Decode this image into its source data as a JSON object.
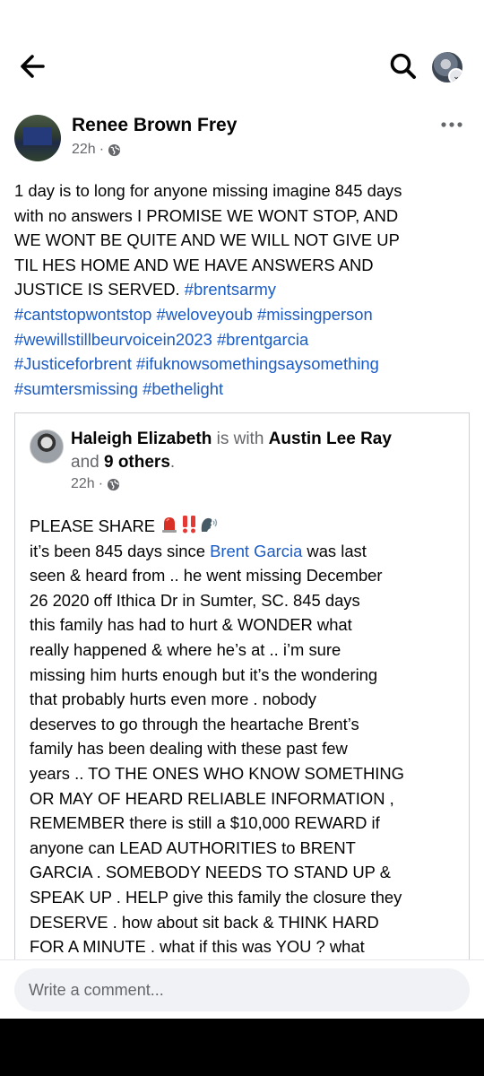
{
  "post": {
    "author": "Renee Brown Frey",
    "time": "22h",
    "separator": "·",
    "text_lines": [
      "1 day is to long for anyone missing imagine 845 days",
      "with no answers I PROMISE WE WONT STOP, AND",
      "WE WONT BE QUITE AND WE WILL NOT GIVE UP",
      "TIL HES HOME AND WE HAVE ANSWERS AND"
    ],
    "text_line5": "JUSTICE IS SERVED. ",
    "hashtags": [
      "#brentsarmy",
      "#cantstopwontstop",
      "#weloveyoub",
      "#missingperson",
      "#wewillstillbeurvoicein2023",
      "#brentgarcia",
      "#Justiceforbrent",
      "#ifuknowsomethingsaysomething",
      "#sumtersmissing",
      "#bethelight"
    ]
  },
  "shared": {
    "author": "Haleigh Elizabeth",
    "with_text": " is with ",
    "with_person": "Austin Lee Ray",
    "and_text": "and ",
    "others": "9 others",
    "period": ".",
    "time": "22h",
    "separator": "·",
    "line1": "PLEASE SHARE ",
    "line2_a": "it’s been 845 days since ",
    "line2_link": "Brent Garcia",
    "line2_b": " was last",
    "lines": [
      "seen & heard from .. he went missing December",
      "26 2020 off Ithica Dr in Sumter, SC. 845 days",
      "this family has had to hurt & WONDER what",
      "really happened & where he’s at .. i’m sure",
      "missing him hurts enough but it’s the wondering",
      "that probably hurts even more . nobody",
      "deserves to go through the heartache Brent’s",
      "family has been dealing with these past few",
      "years .. TO THE ONES WHO KNOW SOMETHING",
      "OR MAY OF HEARD RELIABLE INFORMATION ,",
      "REMEMBER there is still a $10,000 REWARD if",
      "anyone can LEAD AUTHORITIES to BRENT",
      "GARCIA . SOMEBODY NEEDS TO STAND UP &",
      "SPEAK UP . HELP give this family the closure they",
      "DESERVE . how about sit back & THINK HARD",
      "FOR A MINUTE . what if this was YOU ? what"
    ]
  },
  "comment": {
    "placeholder": "Write a comment..."
  },
  "icons": {
    "back": "arrow-left-icon",
    "search": "search-icon",
    "more": "more-horizontal-icon",
    "privacy": "globe-icon",
    "emojis": [
      "siren-emoji",
      "double-exclamation-emoji",
      "speaking-head-emoji"
    ]
  },
  "colors": {
    "link": "#1b5cc4",
    "secondary_text": "#65676b",
    "comment_bg": "#f0f2f5"
  }
}
